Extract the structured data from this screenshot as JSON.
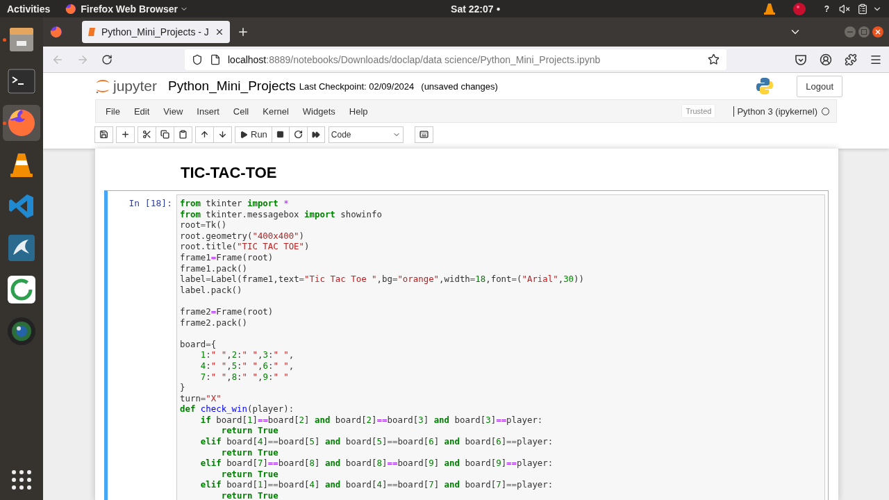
{
  "top_bar": {
    "activities": "Activities",
    "app_menu": "Firefox Web Browser",
    "clock": "Sat 22:07",
    "clock_dot": "●",
    "help": "?"
  },
  "dock": [
    {
      "kind": "files",
      "running": true,
      "active": false
    },
    {
      "kind": "terminal",
      "running": false,
      "active": false
    },
    {
      "kind": "firefox",
      "running": true,
      "active": true
    },
    {
      "kind": "vlc",
      "running": false,
      "active": false
    },
    {
      "kind": "vscode",
      "running": false,
      "active": false
    },
    {
      "kind": "mysql",
      "running": false,
      "active": false
    },
    {
      "kind": "ring",
      "running": false,
      "active": false
    },
    {
      "kind": "lens",
      "running": false,
      "active": false
    }
  ],
  "browser": {
    "tab": {
      "title": "Python_Mini_Projects - J",
      "selected": true
    },
    "address": {
      "host": "localhost",
      "path": ":8889/notebooks/Downloads/doclap/data science/Python_Mini_Projects.ipynb"
    },
    "back_disabled": true,
    "forward_disabled": true
  },
  "jupyter": {
    "logo": "jupyter",
    "notebook_name": "Python_Mini_Projects",
    "checkpoint": "Last Checkpoint: 02/09/2024",
    "unsaved": "(unsaved changes)",
    "logout": "Logout",
    "menu": [
      "File",
      "Edit",
      "View",
      "Insert",
      "Cell",
      "Kernel",
      "Widgets",
      "Help"
    ],
    "trusted": "Trusted",
    "kernel": "Python 3 (ipykernel)",
    "kernel_busy": false,
    "run_label": "Run",
    "cell_type": "Code"
  },
  "heading": "TIC-TAC-TOE",
  "cell": {
    "prompt": "In [18]:",
    "selected": true,
    "lines": [
      {
        "kind": "code",
        "tokens": [
          {
            "kind": "keyword",
            "text": "from"
          },
          {
            "kind": "plain",
            "text": " tkinter "
          },
          {
            "kind": "keyword",
            "text": "import"
          },
          {
            "kind": "operator",
            "text": " *"
          }
        ]
      },
      {
        "kind": "code",
        "tokens": [
          {
            "kind": "keyword",
            "text": "from"
          },
          {
            "kind": "plain",
            "text": " tkinter.messagebox "
          },
          {
            "kind": "keyword",
            "text": "import"
          },
          {
            "kind": "plain",
            "text": " showinfo"
          }
        ]
      },
      {
        "kind": "code",
        "tokens": [
          {
            "kind": "plain",
            "text": "root"
          },
          {
            "kind": "operator",
            "text": "="
          },
          {
            "kind": "plain",
            "text": "Tk()"
          }
        ]
      },
      {
        "kind": "code",
        "tokens": [
          {
            "kind": "plain",
            "text": "root.geometry("
          },
          {
            "kind": "string",
            "text": "\"400x400\""
          },
          {
            "kind": "plain",
            "text": ")"
          }
        ]
      },
      {
        "kind": "code",
        "tokens": [
          {
            "kind": "plain",
            "text": "root.title("
          },
          {
            "kind": "string",
            "text": "\"TIC TAC TOE\""
          },
          {
            "kind": "plain",
            "text": ")"
          }
        ]
      },
      {
        "kind": "code",
        "tokens": [
          {
            "kind": "plain",
            "text": "frame1"
          },
          {
            "kind": "operator",
            "text": "="
          },
          {
            "kind": "plain",
            "text": "Frame(root)"
          }
        ]
      },
      {
        "kind": "code",
        "tokens": [
          {
            "kind": "plain",
            "text": "frame1.pack()"
          }
        ]
      },
      {
        "kind": "code",
        "tokens": [
          {
            "kind": "plain",
            "text": "label"
          },
          {
            "kind": "operator",
            "text": "="
          },
          {
            "kind": "plain",
            "text": "Label(frame1,text"
          },
          {
            "kind": "operator",
            "text": "="
          },
          {
            "kind": "string",
            "text": "\"Tic Tac Toe \""
          },
          {
            "kind": "plain",
            "text": ",bg"
          },
          {
            "kind": "operator",
            "text": "="
          },
          {
            "kind": "string",
            "text": "\"orange\""
          },
          {
            "kind": "plain",
            "text": ",width"
          },
          {
            "kind": "operator",
            "text": "="
          },
          {
            "kind": "number",
            "text": "18"
          },
          {
            "kind": "plain",
            "text": ",font"
          },
          {
            "kind": "operator",
            "text": "="
          },
          {
            "kind": "plain",
            "text": "("
          },
          {
            "kind": "string",
            "text": "\"Arial\""
          },
          {
            "kind": "plain",
            "text": ","
          },
          {
            "kind": "number",
            "text": "30"
          },
          {
            "kind": "plain",
            "text": "))"
          }
        ]
      },
      {
        "kind": "code",
        "tokens": [
          {
            "kind": "plain",
            "text": "label.pack()"
          }
        ]
      },
      {
        "kind": "blank"
      },
      {
        "kind": "code",
        "tokens": [
          {
            "kind": "plain",
            "text": "frame2"
          },
          {
            "kind": "operator",
            "text": "="
          },
          {
            "kind": "plain",
            "text": "Frame(root)"
          }
        ]
      },
      {
        "kind": "code",
        "tokens": [
          {
            "kind": "plain",
            "text": "frame2.pack()"
          }
        ]
      },
      {
        "kind": "blank"
      },
      {
        "kind": "code",
        "tokens": [
          {
            "kind": "plain",
            "text": "board"
          },
          {
            "kind": "operator",
            "text": "="
          },
          {
            "kind": "plain",
            "text": "{"
          }
        ]
      },
      {
        "kind": "code",
        "tokens": [
          {
            "kind": "number",
            "text": "    1"
          },
          {
            "kind": "plain",
            "text": ":"
          },
          {
            "kind": "string",
            "text": "\" \""
          },
          {
            "kind": "plain",
            "text": ","
          },
          {
            "kind": "number",
            "text": "2"
          },
          {
            "kind": "plain",
            "text": ":"
          },
          {
            "kind": "string",
            "text": "\" \""
          },
          {
            "kind": "plain",
            "text": ","
          },
          {
            "kind": "number",
            "text": "3"
          },
          {
            "kind": "plain",
            "text": ":"
          },
          {
            "kind": "string",
            "text": "\" \""
          },
          {
            "kind": "plain",
            "text": ","
          }
        ]
      },
      {
        "kind": "code",
        "tokens": [
          {
            "kind": "number",
            "text": "    4"
          },
          {
            "kind": "plain",
            "text": ":"
          },
          {
            "kind": "string",
            "text": "\" \""
          },
          {
            "kind": "plain",
            "text": ","
          },
          {
            "kind": "number",
            "text": "5"
          },
          {
            "kind": "plain",
            "text": ":"
          },
          {
            "kind": "string",
            "text": "\" \""
          },
          {
            "kind": "plain",
            "text": ","
          },
          {
            "kind": "number",
            "text": "6"
          },
          {
            "kind": "plain",
            "text": ":"
          },
          {
            "kind": "string",
            "text": "\" \""
          },
          {
            "kind": "plain",
            "text": ","
          }
        ]
      },
      {
        "kind": "code",
        "tokens": [
          {
            "kind": "number",
            "text": "    7"
          },
          {
            "kind": "plain",
            "text": ":"
          },
          {
            "kind": "string",
            "text": "\" \""
          },
          {
            "kind": "plain",
            "text": ","
          },
          {
            "kind": "number",
            "text": "8"
          },
          {
            "kind": "plain",
            "text": ":"
          },
          {
            "kind": "string",
            "text": "\" \""
          },
          {
            "kind": "plain",
            "text": ","
          },
          {
            "kind": "number",
            "text": "9"
          },
          {
            "kind": "plain",
            "text": ":"
          },
          {
            "kind": "string",
            "text": "\" \""
          }
        ]
      },
      {
        "kind": "code",
        "tokens": [
          {
            "kind": "plain",
            "text": "}"
          }
        ]
      },
      {
        "kind": "code",
        "tokens": [
          {
            "kind": "plain",
            "text": "turn"
          },
          {
            "kind": "operator",
            "text": "="
          },
          {
            "kind": "string",
            "text": "\"X\""
          }
        ]
      },
      {
        "kind": "code",
        "tokens": [
          {
            "kind": "keyword",
            "text": "def "
          },
          {
            "kind": "function",
            "text": "check_win"
          },
          {
            "kind": "plain",
            "text": "(player):"
          }
        ]
      },
      {
        "kind": "code",
        "tokens": [
          {
            "kind": "keyword",
            "text": "    if"
          },
          {
            "kind": "plain",
            "text": " board["
          },
          {
            "kind": "number",
            "text": "1"
          },
          {
            "kind": "plain",
            "text": "]"
          },
          {
            "kind": "operator",
            "text": "=="
          },
          {
            "kind": "plain",
            "text": "board["
          },
          {
            "kind": "number",
            "text": "2"
          },
          {
            "kind": "plain",
            "text": "] "
          },
          {
            "kind": "keyword",
            "text": "and"
          },
          {
            "kind": "plain",
            "text": " board["
          },
          {
            "kind": "number",
            "text": "2"
          },
          {
            "kind": "plain",
            "text": "]"
          },
          {
            "kind": "operator",
            "text": "=="
          },
          {
            "kind": "plain",
            "text": "board["
          },
          {
            "kind": "number",
            "text": "3"
          },
          {
            "kind": "plain",
            "text": "] "
          },
          {
            "kind": "keyword",
            "text": "and"
          },
          {
            "kind": "plain",
            "text": " board["
          },
          {
            "kind": "number",
            "text": "3"
          },
          {
            "kind": "plain",
            "text": "]"
          },
          {
            "kind": "operator",
            "text": "=="
          },
          {
            "kind": "plain",
            "text": "player:"
          }
        ]
      },
      {
        "kind": "code",
        "tokens": [
          {
            "kind": "keyword",
            "text": "        return True"
          }
        ]
      },
      {
        "kind": "code",
        "tokens": [
          {
            "kind": "keyword",
            "text": "    elif"
          },
          {
            "kind": "plain",
            "text": " board["
          },
          {
            "kind": "number",
            "text": "4"
          },
          {
            "kind": "plain",
            "text": "]"
          },
          {
            "kind": "operator",
            "text": "=="
          },
          {
            "kind": "plain",
            "text": "board["
          },
          {
            "kind": "number",
            "text": "5"
          },
          {
            "kind": "plain",
            "text": "] "
          },
          {
            "kind": "keyword",
            "text": "and"
          },
          {
            "kind": "plain",
            "text": " board["
          },
          {
            "kind": "number",
            "text": "5"
          },
          {
            "kind": "plain",
            "text": "]"
          },
          {
            "kind": "operator",
            "text": "=="
          },
          {
            "kind": "plain",
            "text": "board["
          },
          {
            "kind": "number",
            "text": "6"
          },
          {
            "kind": "plain",
            "text": "] "
          },
          {
            "kind": "keyword",
            "text": "and"
          },
          {
            "kind": "plain",
            "text": " board["
          },
          {
            "kind": "number",
            "text": "6"
          },
          {
            "kind": "plain",
            "text": "]"
          },
          {
            "kind": "operator",
            "text": "=="
          },
          {
            "kind": "plain",
            "text": "player:"
          }
        ]
      },
      {
        "kind": "code",
        "tokens": [
          {
            "kind": "keyword",
            "text": "        return True"
          }
        ]
      },
      {
        "kind": "code",
        "tokens": [
          {
            "kind": "keyword",
            "text": "    elif"
          },
          {
            "kind": "plain",
            "text": " board["
          },
          {
            "kind": "number",
            "text": "7"
          },
          {
            "kind": "plain",
            "text": "]"
          },
          {
            "kind": "operator",
            "text": "=="
          },
          {
            "kind": "plain",
            "text": "board["
          },
          {
            "kind": "number",
            "text": "8"
          },
          {
            "kind": "plain",
            "text": "] "
          },
          {
            "kind": "keyword",
            "text": "and"
          },
          {
            "kind": "plain",
            "text": " board["
          },
          {
            "kind": "number",
            "text": "8"
          },
          {
            "kind": "plain",
            "text": "]"
          },
          {
            "kind": "operator",
            "text": "=="
          },
          {
            "kind": "plain",
            "text": "board["
          },
          {
            "kind": "number",
            "text": "9"
          },
          {
            "kind": "plain",
            "text": "] "
          },
          {
            "kind": "keyword",
            "text": "and"
          },
          {
            "kind": "plain",
            "text": " board["
          },
          {
            "kind": "number",
            "text": "9"
          },
          {
            "kind": "plain",
            "text": "]"
          },
          {
            "kind": "operator",
            "text": "=="
          },
          {
            "kind": "plain",
            "text": "player:"
          }
        ]
      },
      {
        "kind": "code",
        "tokens": [
          {
            "kind": "keyword",
            "text": "        return True"
          }
        ]
      },
      {
        "kind": "code",
        "tokens": [
          {
            "kind": "keyword",
            "text": "    elif"
          },
          {
            "kind": "plain",
            "text": " board["
          },
          {
            "kind": "number",
            "text": "1"
          },
          {
            "kind": "plain",
            "text": "]"
          },
          {
            "kind": "operator",
            "text": "=="
          },
          {
            "kind": "plain",
            "text": "board["
          },
          {
            "kind": "number",
            "text": "4"
          },
          {
            "kind": "plain",
            "text": "] "
          },
          {
            "kind": "keyword",
            "text": "and"
          },
          {
            "kind": "plain",
            "text": " board["
          },
          {
            "kind": "number",
            "text": "4"
          },
          {
            "kind": "plain",
            "text": "]"
          },
          {
            "kind": "operator",
            "text": "=="
          },
          {
            "kind": "plain",
            "text": "board["
          },
          {
            "kind": "number",
            "text": "7"
          },
          {
            "kind": "plain",
            "text": "] "
          },
          {
            "kind": "keyword",
            "text": "and"
          },
          {
            "kind": "plain",
            "text": " board["
          },
          {
            "kind": "number",
            "text": "7"
          },
          {
            "kind": "plain",
            "text": "]"
          },
          {
            "kind": "operator",
            "text": "=="
          },
          {
            "kind": "plain",
            "text": "player:"
          }
        ]
      },
      {
        "kind": "code",
        "tokens": [
          {
            "kind": "keyword",
            "text": "        return True"
          }
        ]
      }
    ]
  }
}
